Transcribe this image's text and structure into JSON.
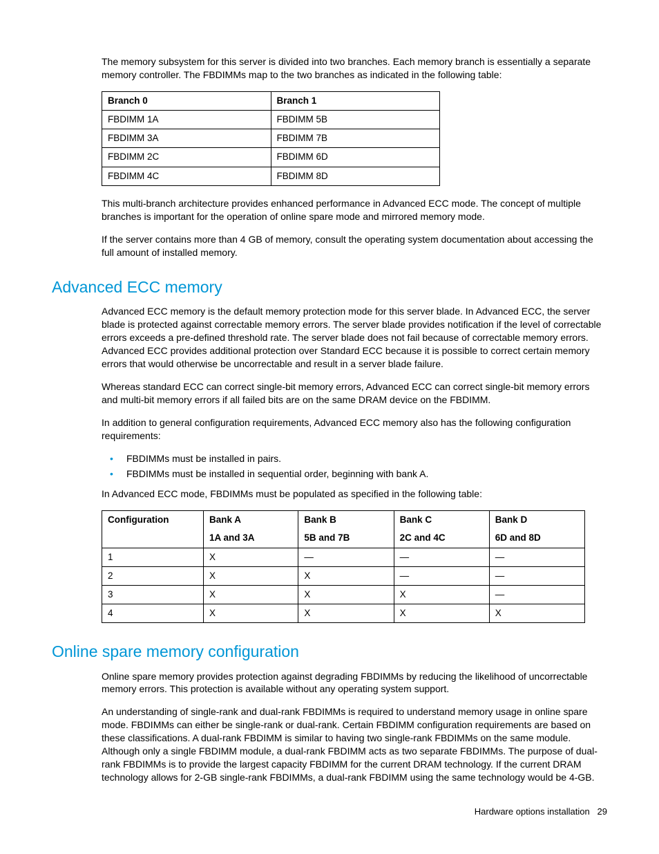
{
  "intro": {
    "p1": "The memory subsystem for this server is divided into two branches. Each memory branch is essentially a separate memory controller. The FBDIMMs map to the two branches as indicated in the following table:",
    "p2": "This multi-branch architecture provides enhanced performance in Advanced ECC mode. The concept of multiple branches is important for the operation of online spare mode and mirrored memory mode.",
    "p3": "If the server contains more than 4 GB of memory, consult the operating system documentation about accessing the full amount of installed memory."
  },
  "branch_table": {
    "headers": {
      "h0": "Branch 0",
      "h1": "Branch 1"
    },
    "rows": {
      "r0c0": "FBDIMM 1A",
      "r0c1": "FBDIMM 5B",
      "r1c0": "FBDIMM 3A",
      "r1c1": "FBDIMM 7B",
      "r2c0": "FBDIMM 2C",
      "r2c1": "FBDIMM 6D",
      "r3c0": "FBDIMM 4C",
      "r3c1": "FBDIMM 8D"
    }
  },
  "adv_ecc": {
    "heading": "Advanced ECC memory",
    "p1": "Advanced ECC memory is the default memory protection mode for this server blade. In Advanced ECC, the server blade is protected against correctable memory errors. The server blade provides notification if the level of correctable errors exceeds a pre-defined threshold rate. The server blade does not fail because of correctable memory errors. Advanced ECC provides additional protection over Standard ECC because it is possible to correct certain memory errors that would otherwise be uncorrectable and result in a server blade failure.",
    "p2": "Whereas standard ECC can correct single-bit memory errors, Advanced ECC can correct single-bit memory errors and multi-bit memory errors if all failed bits are on the same DRAM device on the FBDIMM.",
    "p3": "In addition to general configuration requirements, Advanced ECC memory also has the following configuration requirements:",
    "bullets": {
      "b1": "FBDIMMs must be installed in pairs.",
      "b2": "FBDIMMs must be installed in sequential order, beginning with bank A."
    },
    "p4": "In Advanced ECC mode, FBDIMMs must be populated as specified in the following table:"
  },
  "config_table": {
    "headers": {
      "config": "Configuration",
      "bankA": "Bank A",
      "bankA_sub": "1A and 3A",
      "bankB": "Bank B",
      "bankB_sub": "5B and 7B",
      "bankC": "Bank C",
      "bankC_sub": "2C and 4C",
      "bankD": "Bank D",
      "bankD_sub": "6D and 8D"
    },
    "rows": {
      "r0": {
        "c": "1",
        "a": "X",
        "b": "—",
        "cc": "—",
        "d": "—"
      },
      "r1": {
        "c": "2",
        "a": "X",
        "b": "X",
        "cc": "—",
        "d": "—"
      },
      "r2": {
        "c": "3",
        "a": "X",
        "b": "X",
        "cc": "X",
        "d": "—"
      },
      "r3": {
        "c": "4",
        "a": "X",
        "b": "X",
        "cc": "X",
        "d": "X"
      }
    }
  },
  "online_spare": {
    "heading": "Online spare memory configuration",
    "p1": "Online spare memory provides protection against degrading FBDIMMs by reducing the likelihood of uncorrectable memory errors. This protection is available without any operating system support.",
    "p2": "An understanding of single-rank and dual-rank FBDIMMs is required to understand memory usage in online spare mode. FBDIMMs can either be single-rank or dual-rank. Certain FBDIMM configuration requirements are based on these classifications. A dual-rank FBDIMM is similar to having two single-rank FBDIMMs on the same module. Although only a single FBDIMM module, a dual-rank FBDIMM acts as two separate FBDIMMs. The purpose of dual-rank FBDIMMs is to provide the largest capacity FBDIMM for the current DRAM technology. If the current DRAM technology allows for 2-GB single-rank FBDIMMs, a dual-rank FBDIMM using the same technology would be 4-GB."
  },
  "footer": {
    "section": "Hardware options installation",
    "page": "29"
  }
}
